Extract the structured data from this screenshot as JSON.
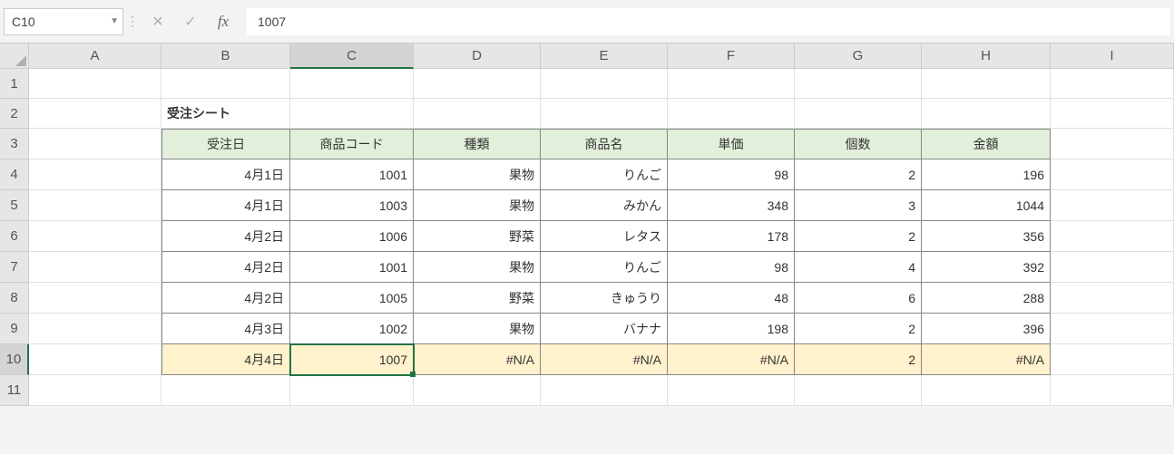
{
  "namebox": "C10",
  "formula_value": "1007",
  "fx_label": "fx",
  "columns": [
    "A",
    "B",
    "C",
    "D",
    "E",
    "F",
    "G",
    "H",
    "I"
  ],
  "rownums": [
    "1",
    "2",
    "3",
    "4",
    "5",
    "6",
    "7",
    "8",
    "9",
    "10",
    "11"
  ],
  "active_col": "C",
  "active_row": "10",
  "sheet": {
    "title": "受注シート",
    "headers": {
      "b": "受注日",
      "c": "商品コード",
      "d": "種類",
      "e": "商品名",
      "f": "単価",
      "g": "個数",
      "h": "金額"
    },
    "rows": [
      {
        "b": "4月1日",
        "c": "1001",
        "d": "果物",
        "e": "りんご",
        "f": "98",
        "g": "2",
        "h": "196"
      },
      {
        "b": "4月1日",
        "c": "1003",
        "d": "果物",
        "e": "みかん",
        "f": "348",
        "g": "3",
        "h": "1044"
      },
      {
        "b": "4月2日",
        "c": "1006",
        "d": "野菜",
        "e": "レタス",
        "f": "178",
        "g": "2",
        "h": "356"
      },
      {
        "b": "4月2日",
        "c": "1001",
        "d": "果物",
        "e": "りんご",
        "f": "98",
        "g": "4",
        "h": "392"
      },
      {
        "b": "4月2日",
        "c": "1005",
        "d": "野菜",
        "e": "きゅうり",
        "f": "48",
        "g": "6",
        "h": "288"
      },
      {
        "b": "4月3日",
        "c": "1002",
        "d": "果物",
        "e": "バナナ",
        "f": "198",
        "g": "2",
        "h": "396"
      },
      {
        "b": "4月4日",
        "c": "1007",
        "d": "#N/A",
        "e": "#N/A",
        "f": "#N/A",
        "g": "2",
        "h": "#N/A"
      }
    ]
  }
}
